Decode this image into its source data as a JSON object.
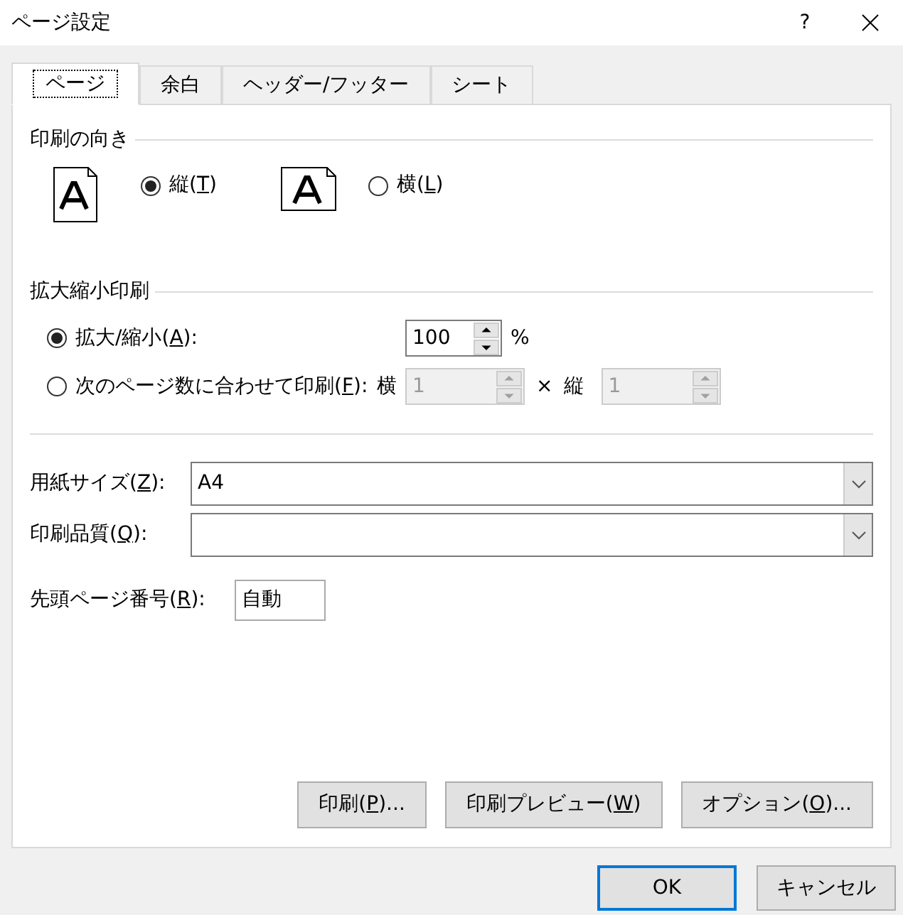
{
  "window": {
    "title": "ページ設定",
    "help": "?"
  },
  "tabs": [
    {
      "label": "ページ",
      "selected": true
    },
    {
      "label": "余白",
      "selected": false
    },
    {
      "label": "ヘッダー/フッター",
      "selected": false
    },
    {
      "label": "シート",
      "selected": false
    }
  ],
  "orientation": {
    "title": "印刷の向き",
    "options": [
      {
        "pre": "縦(",
        "key": "T",
        "post": ")",
        "kind": "portrait",
        "selected": true
      },
      {
        "pre": "横(",
        "key": "L",
        "post": ")",
        "kind": "landscape",
        "selected": false
      }
    ]
  },
  "scaling": {
    "title": "拡大縮小印刷",
    "adjust": {
      "pre": "拡大/縮小(",
      "key": "A",
      "post": "):",
      "selected": true,
      "value": "100",
      "unit": "%",
      "disabled": false
    },
    "fit": {
      "pre": "次のページ数に合わせて印刷(",
      "key": "F",
      "post": "):",
      "selected": false,
      "wide_label": "横",
      "wide_value": "1",
      "times": "×",
      "tall_label": "縦",
      "tall_value": "1",
      "disabled": true
    }
  },
  "paper_size": {
    "pre": "用紙サイズ(",
    "key": "Z",
    "post": "):",
    "value": "A4"
  },
  "print_quality": {
    "pre": "印刷品質(",
    "key": "Q",
    "post": "):"
  },
  "first_page": {
    "pre": "先頭ページ番号(",
    "key": "R",
    "post": "):",
    "value": "自動"
  },
  "panel_buttons": [
    {
      "pre": "印刷(",
      "key": "P",
      "post": ")..."
    },
    {
      "pre": "印刷プレビュー(",
      "key": "W",
      "post": ")"
    },
    {
      "pre": "オプション(",
      "key": "O",
      "post": ")..."
    }
  ],
  "buttons": [
    {
      "label": "OK",
      "default": true
    },
    {
      "label": "キャンセル",
      "default": false
    }
  ]
}
